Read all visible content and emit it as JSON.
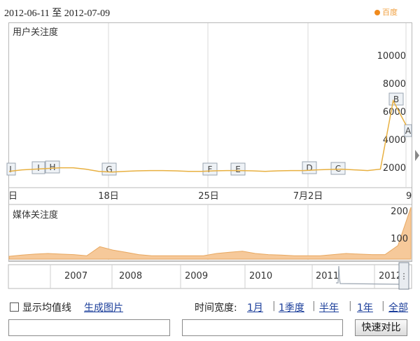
{
  "header": {
    "date_range": "2012-06-11 至 2012-07-09",
    "brand": "百度"
  },
  "user_chart": {
    "title": "用户关注度",
    "y_ticks": [
      "2000",
      "4000",
      "6000",
      "8000",
      "10000"
    ],
    "x_ticks": [
      "日",
      "18日",
      "25日",
      "7月2日",
      "9"
    ],
    "events": [
      "I",
      "I",
      "H",
      "G",
      "F",
      "E",
      "D",
      "C",
      "B",
      "A"
    ],
    "series_values": [
      950,
      1050,
      1100,
      1150,
      1200,
      1200,
      1100,
      950,
      900,
      950,
      980,
      1000,
      1000,
      980,
      950,
      950,
      980,
      1000,
      1000,
      980,
      950,
      980,
      1000,
      1000,
      1050,
      1080,
      1100,
      1050,
      1000,
      1100,
      5900,
      4200
    ],
    "ylim": [
      0,
      11000
    ],
    "line_color": "#e8b040"
  },
  "media_chart": {
    "title": "媒体关注度",
    "y_ticks": [
      "100",
      "200"
    ],
    "series_values": [
      12,
      18,
      22,
      25,
      22,
      20,
      15,
      55,
      40,
      30,
      20,
      15,
      15,
      15,
      15,
      15,
      25,
      30,
      35,
      25,
      20,
      18,
      15,
      15,
      15,
      20,
      25,
      22,
      20,
      20,
      60,
      230
    ],
    "ylim": [
      0,
      230
    ],
    "fill_color": "#f6c99a",
    "line_color": "#e8a860"
  },
  "timeline": {
    "years": [
      "2007",
      "2008",
      "2009",
      "2010",
      "2011",
      "2012"
    ]
  },
  "options": {
    "show_avg_label": "显示均值线",
    "gen_image_label": "生成图片",
    "time_width_label": "时间宽度:",
    "time_options": [
      "1月",
      "1季度",
      "半年",
      "1年",
      "全部"
    ]
  },
  "compare": {
    "input_left_value": "",
    "input_right_value": "",
    "button_label": "快速对比"
  }
}
